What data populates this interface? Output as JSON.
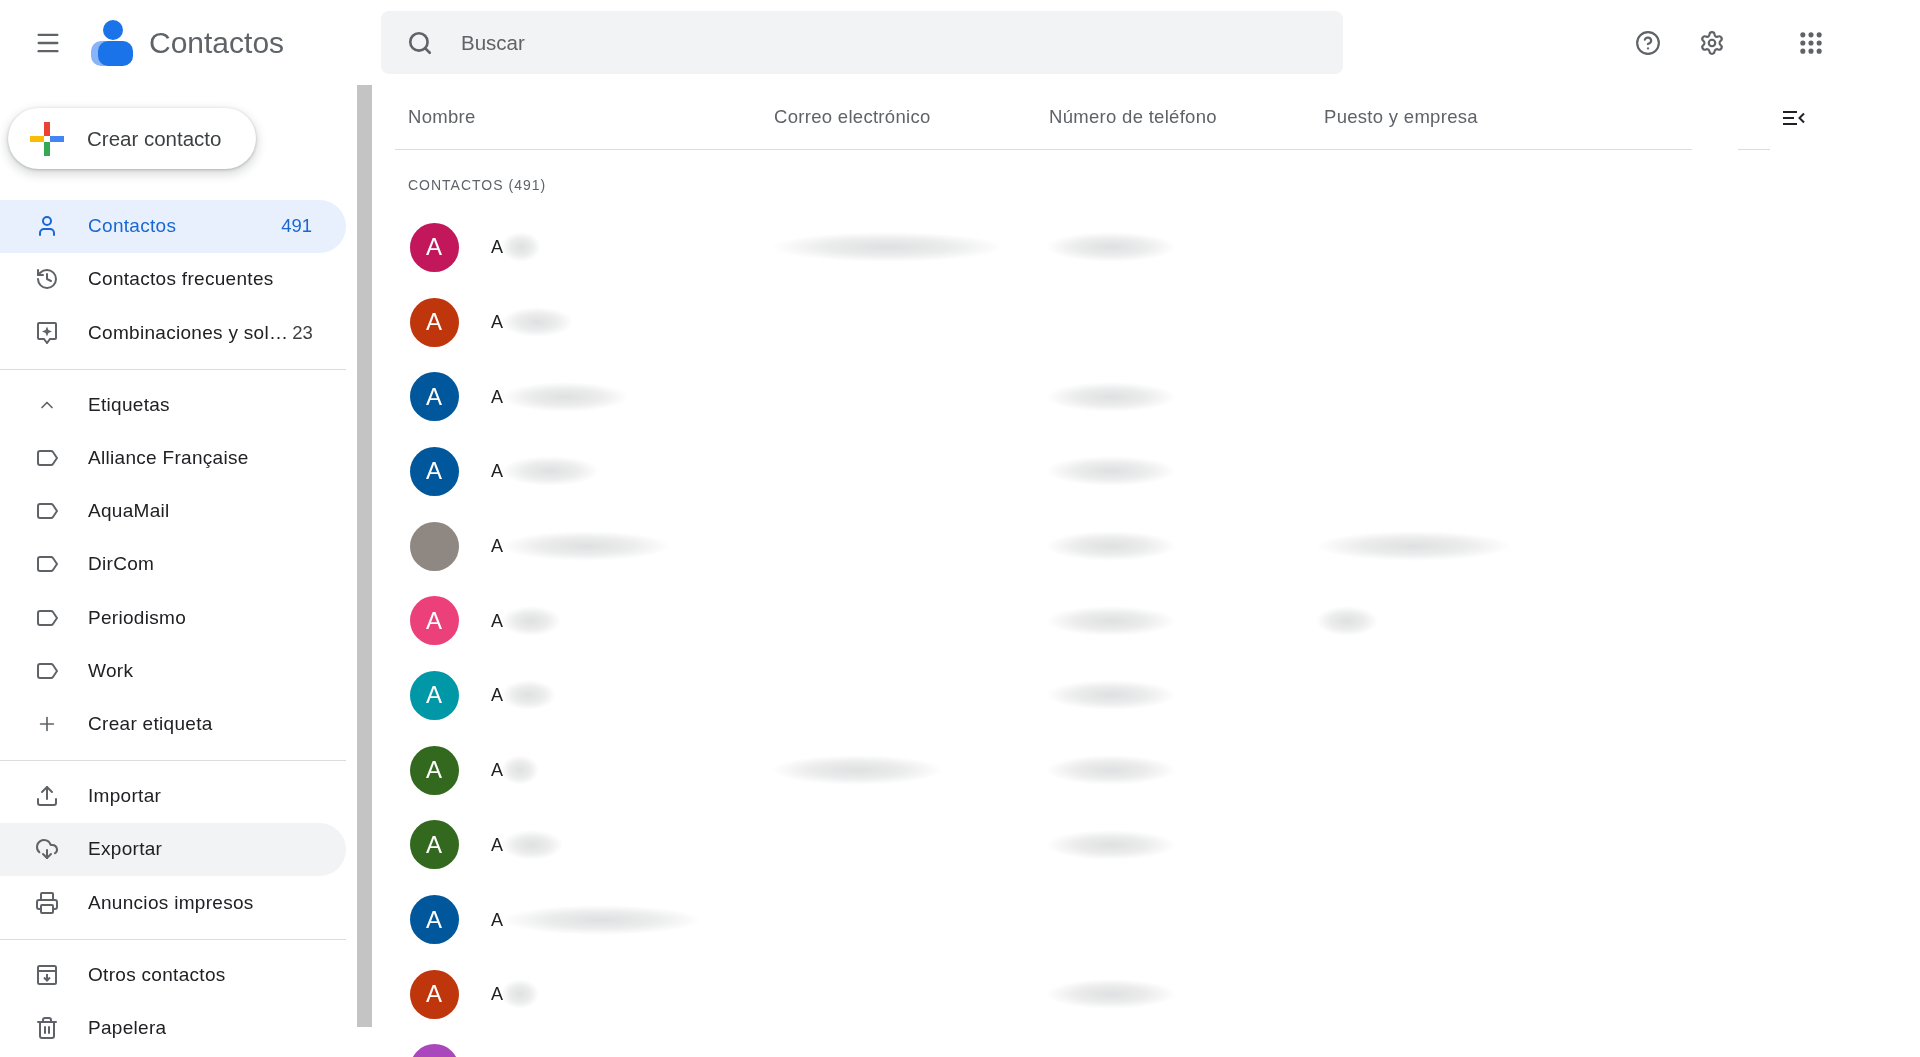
{
  "app": {
    "title": "Contactos"
  },
  "search": {
    "placeholder": "Buscar"
  },
  "sidebar": {
    "create_button": "Crear contacto",
    "sections": [
      {
        "kind": "nav",
        "items": [
          {
            "label": "Contactos",
            "count": "491",
            "selected": true,
            "hovered": false
          },
          {
            "label": "Contactos frecuentes",
            "selected": false,
            "hovered": false
          },
          {
            "label": "Combinaciones y sol…",
            "count": "23",
            "selected": false,
            "hovered": false
          }
        ]
      },
      {
        "kind": "labels",
        "title": "Etiquetas",
        "expanded": true,
        "items": [
          {
            "label": "Alliance Française",
            "selected": false,
            "hovered": false
          },
          {
            "label": "AquaMail",
            "selected": false,
            "hovered": false
          },
          {
            "label": "DirCom",
            "selected": false,
            "hovered": false
          },
          {
            "label": "Periodismo",
            "selected": false,
            "hovered": false
          },
          {
            "label": "Work",
            "selected": false,
            "hovered": false
          }
        ],
        "create_label": "Crear etiqueta"
      },
      {
        "kind": "nav",
        "items": [
          {
            "label": "Importar",
            "selected": false,
            "hovered": false
          },
          {
            "label": "Exportar",
            "selected": false,
            "hovered": true
          },
          {
            "label": "Anuncios impresos",
            "selected": false,
            "hovered": false
          }
        ]
      },
      {
        "kind": "nav",
        "items": [
          {
            "label": "Otros contactos",
            "selected": false,
            "hovered": false
          },
          {
            "label": "Papelera",
            "selected": false,
            "hovered": false
          }
        ]
      }
    ]
  },
  "table": {
    "columns": [
      "Nombre",
      "Correo electrónico",
      "Número de teléfono",
      "Puesto y empresa"
    ],
    "section_title": "CONTACTOS (491)",
    "rows": [
      {
        "avatar": {
          "kind": "letter",
          "letter": "A",
          "color": "#c2185b"
        },
        "name": "A",
        "blurred": {
          "name": true,
          "email": true,
          "phone": true,
          "company": false
        }
      },
      {
        "avatar": {
          "kind": "letter",
          "letter": "A",
          "color": "#bf360c"
        },
        "name": "A",
        "blurred": {
          "name": true,
          "email": false,
          "phone": false,
          "company": false
        }
      },
      {
        "avatar": {
          "kind": "letter",
          "letter": "A",
          "color": "#01579b"
        },
        "name": "A",
        "blurred": {
          "name": true,
          "email": false,
          "phone": true,
          "company": false
        }
      },
      {
        "avatar": {
          "kind": "letter",
          "letter": "A",
          "color": "#01579b"
        },
        "name": "A",
        "blurred": {
          "name": true,
          "email": false,
          "phone": true,
          "company": false
        }
      },
      {
        "avatar": {
          "kind": "photo"
        },
        "name": "A",
        "blurred": {
          "name": true,
          "email": false,
          "phone": true,
          "company": true
        }
      },
      {
        "avatar": {
          "kind": "letter",
          "letter": "A",
          "color": "#ec407a"
        },
        "name": "A",
        "blurred": {
          "name": true,
          "email": false,
          "phone": true,
          "company": true
        }
      },
      {
        "avatar": {
          "kind": "letter",
          "letter": "A",
          "color": "#0097a7"
        },
        "name": "A",
        "blurred": {
          "name": true,
          "email": false,
          "phone": true,
          "company": false
        }
      },
      {
        "avatar": {
          "kind": "letter",
          "letter": "A",
          "color": "#33691e"
        },
        "name": "A",
        "blurred": {
          "name": true,
          "email": true,
          "phone": true,
          "company": false
        }
      },
      {
        "avatar": {
          "kind": "letter",
          "letter": "A",
          "color": "#33691e"
        },
        "name": "A",
        "blurred": {
          "name": true,
          "email": false,
          "phone": true,
          "company": false
        }
      },
      {
        "avatar": {
          "kind": "letter",
          "letter": "A",
          "color": "#01579b"
        },
        "name": "A",
        "blurred": {
          "name": true,
          "email": false,
          "phone": false,
          "company": false
        }
      },
      {
        "avatar": {
          "kind": "letter",
          "letter": "A",
          "color": "#bf360c"
        },
        "name": "A",
        "blurred": {
          "name": true,
          "email": false,
          "phone": true,
          "company": false
        }
      },
      {
        "avatar": {
          "kind": "letter",
          "color": "#ab47bc"
        }
      }
    ]
  }
}
